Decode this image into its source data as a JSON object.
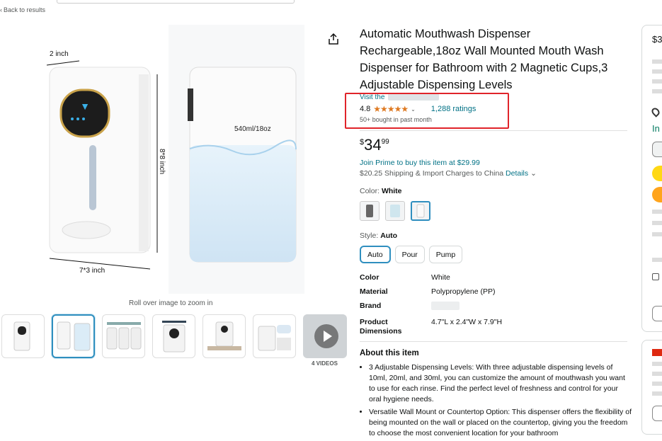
{
  "nav": {
    "back_label": "Back to results"
  },
  "gallery": {
    "zoom_hint": "Roll over image to zoom in",
    "videos_label": "4 VIDEOS",
    "main_image_labels": {
      "width": "2 inch",
      "height": "8*8 inch",
      "base": "7*3 inch",
      "capacity": "540ml/18oz"
    }
  },
  "product": {
    "title": "Automatic Mouthwash Dispenser Rechargeable,18oz Wall Mounted Mouth Wash Dispenser for Bathroom with 2 Magnetic Cups,3 Adjustable Dispensing Levels",
    "store_prefix": "Visit the",
    "rating_value": "4.8",
    "stars": "★★★★★",
    "ratings_count": "1,288 ratings",
    "bought_text": "50+ bought in past month",
    "price_symbol": "$",
    "price_whole": "34",
    "price_fraction": "99",
    "prime_text": "Join Prime to buy this item at $29.99",
    "shipping_text": "$20.25 Shipping & Import Charges to China",
    "details_link": "Details",
    "color_label": "Color:",
    "color_value": "White",
    "style_label": "Style:",
    "style_value": "Auto",
    "styles": [
      "Auto",
      "Pour",
      "Pump"
    ],
    "specs": [
      {
        "key": "Color",
        "value": "White"
      },
      {
        "key": "Material",
        "value": "Polypropylene (PP)"
      },
      {
        "key": "Brand",
        "value": ""
      },
      {
        "key": "Product Dimensions",
        "value": "4.7\"L x 2.4\"W x 7.9\"H"
      }
    ],
    "about_heading": "About this item",
    "about_items": [
      "3 Adjustable Dispensing Levels: With three adjustable dispensing levels of 10ml, 20ml, and 30ml, you can customize the amount of mouthwash you want to use for each rinse. Find the perfect level of freshness and control for your oral hygiene needs.",
      "Versatile Wall Mount or Countertop Option: This dispenser offers the flexibility of being mounted on the wall or placed on the countertop, giving you the freedom to choose the most convenient location for your bathroom"
    ]
  },
  "buybox": {
    "price_fragment": "$3",
    "stock_fragment": "In"
  },
  "colors": {
    "link": "#007185",
    "star": "#de7921",
    "highlight_box": "#e0242a",
    "selected": "#2f8fbf"
  }
}
